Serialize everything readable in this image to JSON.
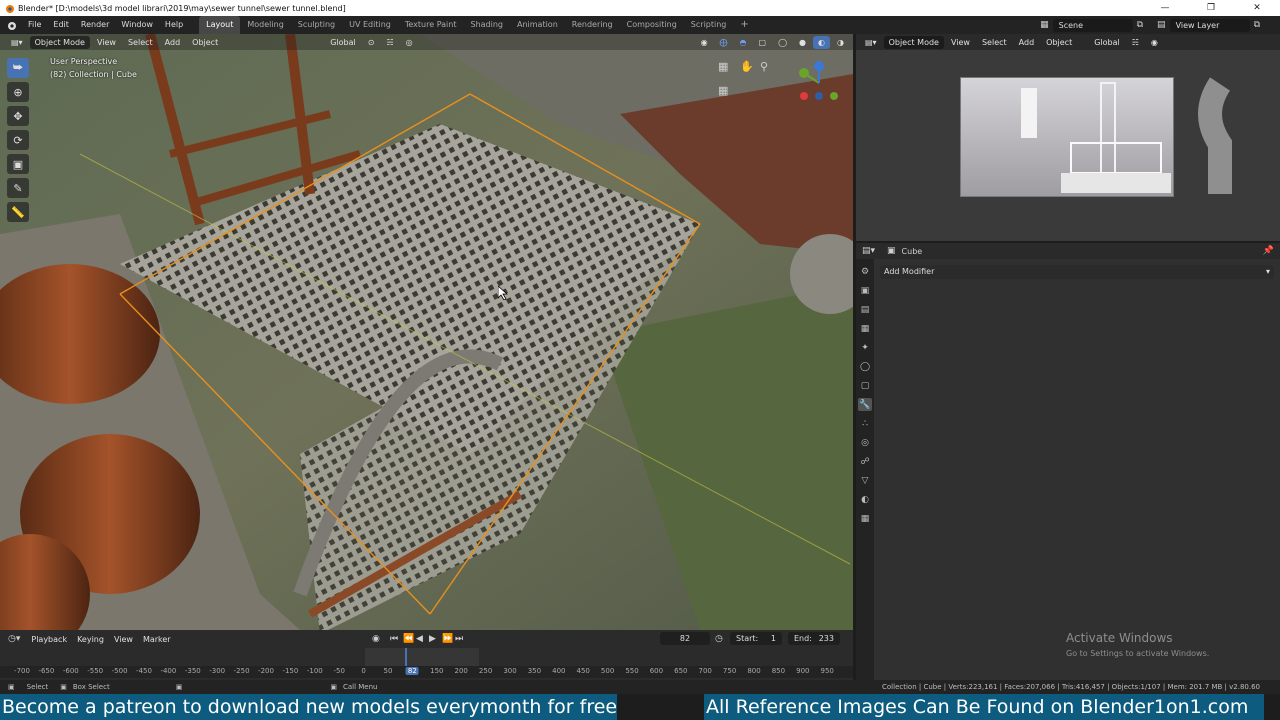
{
  "window": {
    "title": "Blender* [D:\\models\\3d model librari\\2019\\may\\sewer tunnel\\sewer tunnel.blend]"
  },
  "menu": [
    "File",
    "Edit",
    "Render",
    "Window",
    "Help"
  ],
  "workspaces": [
    "Layout",
    "Modeling",
    "Sculpting",
    "UV Editing",
    "Texture Paint",
    "Shading",
    "Animation",
    "Rendering",
    "Compositing",
    "Scripting"
  ],
  "active_workspace": "Layout",
  "scene": {
    "name": "Scene",
    "view_layer": "View Layer"
  },
  "viewport": {
    "mode": "Object Mode",
    "menus": [
      "View",
      "Select",
      "Add",
      "Object"
    ],
    "orientation": "Global",
    "perspective_label": "User Perspective",
    "collection_label": "(82) Collection | Cube"
  },
  "viewport2": {
    "mode": "Object Mode",
    "menus": [
      "View",
      "Select",
      "Add",
      "Object"
    ],
    "orientation": "Global"
  },
  "properties": {
    "object_name": "Cube",
    "add_modifier": "Add Modifier",
    "activate_title": "Activate Windows",
    "activate_sub": "Go to Settings to activate Windows."
  },
  "timeline": {
    "menus": [
      "Playback",
      "Keying",
      "View",
      "Marker"
    ],
    "current_frame": "82",
    "start_label": "Start:",
    "start": "1",
    "end_label": "End:",
    "end": "233",
    "ruler_ticks": [
      "-700",
      "-650",
      "-600",
      "-550",
      "-500",
      "-450",
      "-400",
      "-350",
      "-300",
      "-250",
      "-200",
      "-150",
      "-100",
      "-50",
      "0",
      "50",
      "82",
      "150",
      "200",
      "250",
      "300",
      "350",
      "400",
      "450",
      "500",
      "550",
      "600",
      "650",
      "700",
      "750",
      "800",
      "850",
      "900",
      "950"
    ]
  },
  "statusbar": {
    "select": "Select",
    "box_select": "Box Select",
    "call_menu": "Call Menu",
    "stats": "Collection | Cube | Verts:223,161 | Faces:207,066 | Tris:416,457 | Objects:1/107 | Mem: 201.7 MB | v2.80.60"
  },
  "banners": {
    "left": "Become a patreon to download new models everymonth for free",
    "right": "All Reference Images Can Be Found on Blender1on1.com"
  },
  "colors": {
    "accent": "#4772b3",
    "banner": "#0d5b7e",
    "axis_x": "#e0393e",
    "axis_y": "#6aa42b",
    "axis_z": "#3a78d8"
  },
  "icons": {
    "window_controls": [
      "minimize-icon",
      "restore-icon",
      "close-icon"
    ],
    "tools": [
      "select-box-icon",
      "cursor-icon",
      "move-icon",
      "rotate-icon",
      "scale-icon",
      "annotate-icon",
      "measure-icon"
    ]
  }
}
